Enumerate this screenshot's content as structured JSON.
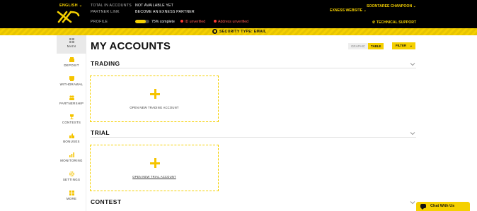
{
  "header": {
    "language": "ENGLISH",
    "total_accounts_label": "TOTAL IN ACCOUNTS",
    "total_accounts_value": "NOT AVAILABLE YET",
    "partner_link_label": "PARTNER LINK",
    "partner_link_value": "BECOME AN EXNESS PARTNER",
    "profile_label": "PROFILE",
    "profile_progress_percent": 75,
    "profile_progress_text": "75% complete",
    "id_status": "ID unverified",
    "address_status": "Address unverified",
    "user_name": "SOONTAREE CHANPOON",
    "exness_website": "EXNESS WEBSITE",
    "technical_support": "TECHNICAL SUPPORT"
  },
  "security_banner": {
    "text": "SECURITY TYPE: EMAIL"
  },
  "sidebar": {
    "items": [
      {
        "label": "MAIN",
        "icon": "grid-icon"
      },
      {
        "label": "DEPOSIT",
        "icon": "deposit-icon"
      },
      {
        "label": "WITHDRAWAL",
        "icon": "withdrawal-icon"
      },
      {
        "label": "PARTNERSHIP",
        "icon": "partnership-icon"
      },
      {
        "label": "CONTESTS",
        "icon": "trophy-icon"
      },
      {
        "label": "BONUSES",
        "icon": "thumbs-up-icon"
      },
      {
        "label": "MONITORING",
        "icon": "monitoring-icon"
      },
      {
        "label": "SETTINGS",
        "icon": "gear-icon"
      },
      {
        "label": "MORE",
        "icon": "more-icon"
      }
    ]
  },
  "main": {
    "title": "MY ACCOUNTS",
    "view_graphic": "GRAPHIC",
    "view_table": "TABLE",
    "filter": "FILTER",
    "sections": [
      {
        "title": "TRADING",
        "card_label": "OPEN NEW TRADING ACCOUNT"
      },
      {
        "title": "TRIAL",
        "card_label": "OPEN NEW TRIAL ACCOUNT"
      },
      {
        "title": "CONTEST"
      }
    ]
  },
  "chat": {
    "label": "Chat With Us"
  },
  "colors": {
    "accent": "#f5d000",
    "header_bg": "#000000",
    "warning": "#ff3b30"
  }
}
